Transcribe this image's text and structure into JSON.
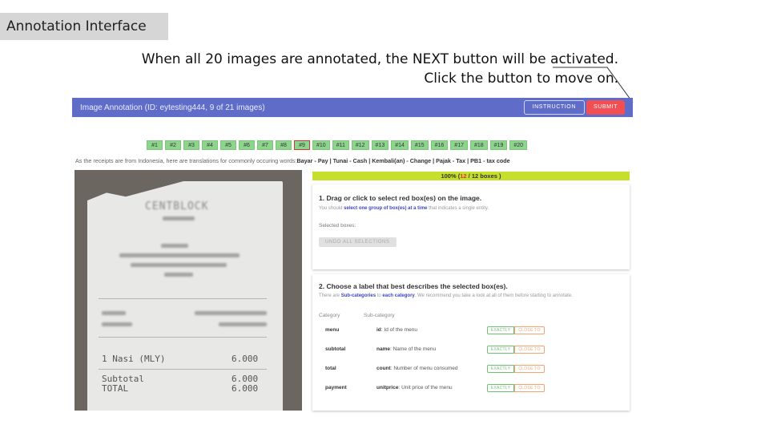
{
  "slide": {
    "title": "Annotation Interface",
    "caption_line1": "When all 20 images are annotated, the NEXT button will be activated.",
    "caption_line2": "Click the button to move on."
  },
  "app": {
    "title": "Image Annotation (ID: eytesting444, 9 of 21 images)",
    "instruction_label": "INSTRUCTION",
    "submit_label": "SUBMIT",
    "accent": "#5f6dc9",
    "submit_color": "#f24f55"
  },
  "image_tabs": [
    "#1",
    "#2",
    "#3",
    "#4",
    "#5",
    "#6",
    "#7",
    "#8",
    "#9",
    "#10",
    "#11",
    "#12",
    "#13",
    "#14",
    "#15",
    "#16",
    "#17",
    "#18",
    "#19",
    "#20"
  ],
  "active_tab": "#9",
  "translations": {
    "intro": "As the receipts are from Indonesia, here are translations for commonly occuring words:",
    "terms": "Bayar - Pay | Tunai - Cash | Kembali(an) - Change | Pajak - Tax | PB1 - tax code"
  },
  "progress": {
    "percent": "100%",
    "open": "(",
    "done": "12",
    "rest": "/ 12 boxes )"
  },
  "step1": {
    "heading": "1. Drag or click to select red box(es) on the image.",
    "help_pre": "You should",
    "help_bold": "select one group of box(es) at a time",
    "help_post": "that indicates a single entity.",
    "selected_label": "Selected boxes:",
    "undo_label": "UNDO ALL SELECTIONS"
  },
  "step2": {
    "heading": "2. Choose a label that best describes the selected box(es).",
    "help_pre": "There are",
    "help_b1": "Sub-categories",
    "help_mid": "to",
    "help_b2": "each category",
    "help_post": ". We recommend you take a look at all of them before starting to annotate.",
    "col_category": "Category",
    "col_subcategory": "Sub-category",
    "exact_label": "EXACTLY",
    "close_label": "CLOSE TO",
    "rows": [
      {
        "category": "menu",
        "sub_key": "id",
        "sub_desc": ": Id of the menu"
      },
      {
        "category": "subtotal",
        "sub_key": "name",
        "sub_desc": ": Name of the menu"
      },
      {
        "category": "total",
        "sub_key": "count",
        "sub_desc": ": Number of menu consumed"
      },
      {
        "category": "payment",
        "sub_key": "unitprice",
        "sub_desc": ": Unit price of the menu"
      }
    ]
  },
  "receipt": {
    "logo": "CENTBLOCK",
    "item_line": "1 Nasi (MLY)",
    "item_amount": "6.000",
    "subtotal_label": "Subtotal",
    "subtotal_amount": "6.000",
    "total_label": "TOTAL",
    "total_amount": "6.000"
  }
}
